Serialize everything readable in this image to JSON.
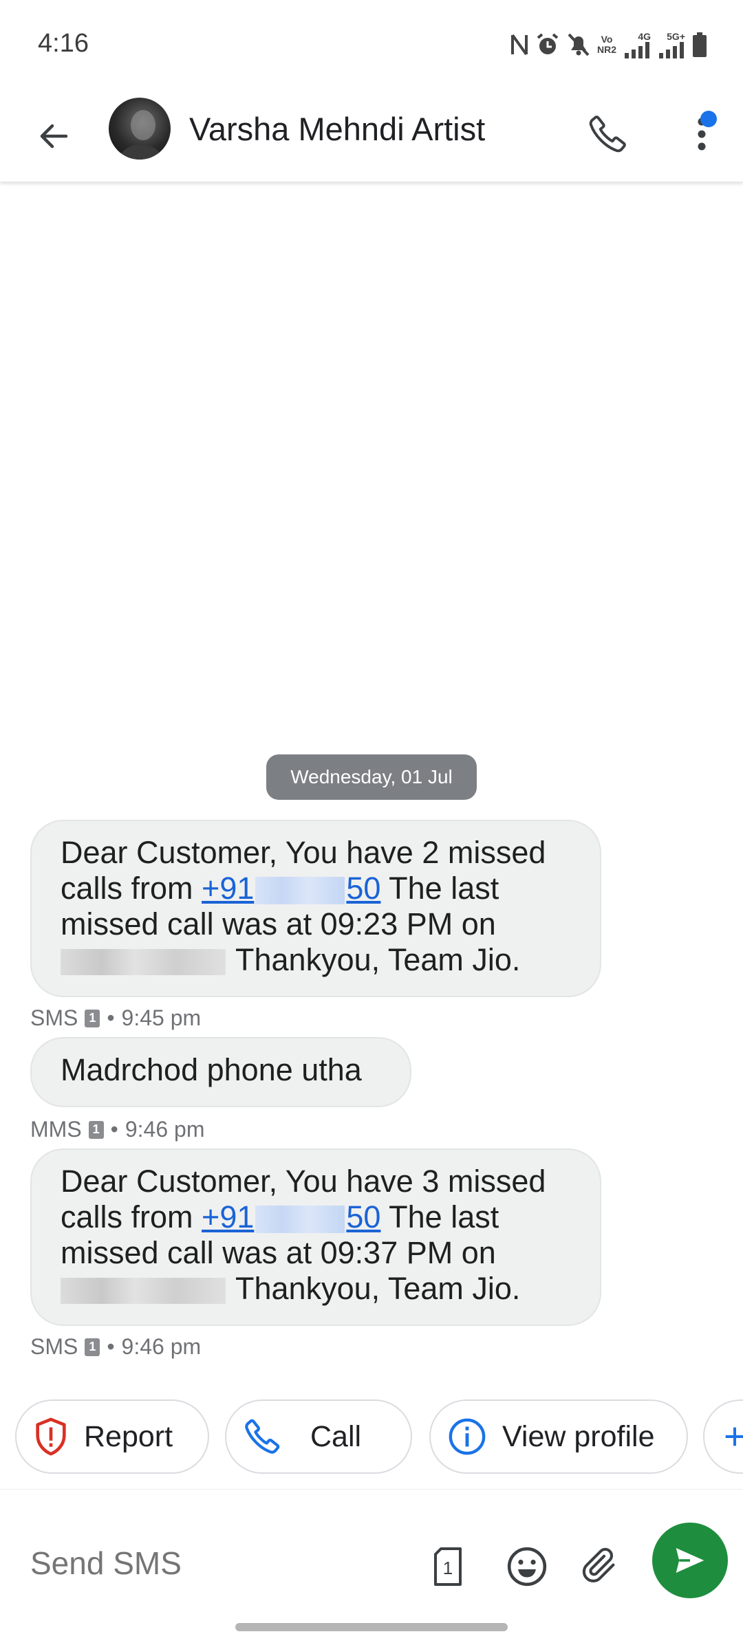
{
  "status_bar": {
    "time": "4:16",
    "icons": [
      "nfc-icon",
      "alarm-icon",
      "mute-icon",
      "volte-icon",
      "signal-4g-icon",
      "signal-5g-icon",
      "battery-icon"
    ],
    "volte_label_top": "Vo",
    "volte_label_bottom": "NR2",
    "net1_label": "4G",
    "net2_label": "5G+"
  },
  "header": {
    "contact_name": "Varsha Mehndi Artist",
    "notification_badge_color": "#1a73e8"
  },
  "conversation": {
    "date_chip": "Wednesday, 01 Jul",
    "messages": [
      {
        "line1": "Dear Customer, You have 2 missed",
        "line2_prefix": "calls from",
        "phone_start": "+91",
        "phone_end": "50",
        "line2_suffix": "The last",
        "line3": "missed call was at 09:23 PM on",
        "line4_suffix": "Thankyou, Team Jio.",
        "type": "SMS",
        "sim": "1",
        "separator": "•",
        "time": "9:45 pm"
      },
      {
        "text": "Madrchod phone utha",
        "type": "MMS",
        "sim": "1",
        "separator": "•",
        "time": "9:46 pm"
      },
      {
        "line1": "Dear Customer, You have 3 missed",
        "line2_prefix": "calls from",
        "phone_start": "+91",
        "phone_end": "50",
        "line2_suffix": "The last",
        "line3": "missed call was at 09:37 PM on",
        "line4_suffix": "Thankyou, Team Jio.",
        "type": "SMS",
        "sim": "1",
        "separator": "•",
        "time": "9:46 pm"
      }
    ]
  },
  "suggestions": [
    {
      "label": "Report",
      "icon": "report-shield-icon"
    },
    {
      "label": "Call",
      "icon": "phone-icon"
    },
    {
      "label": "View profile",
      "icon": "info-icon"
    }
  ],
  "compose": {
    "placeholder": "Send SMS",
    "sim_number": "1",
    "send_color": "#1e8e3e"
  }
}
